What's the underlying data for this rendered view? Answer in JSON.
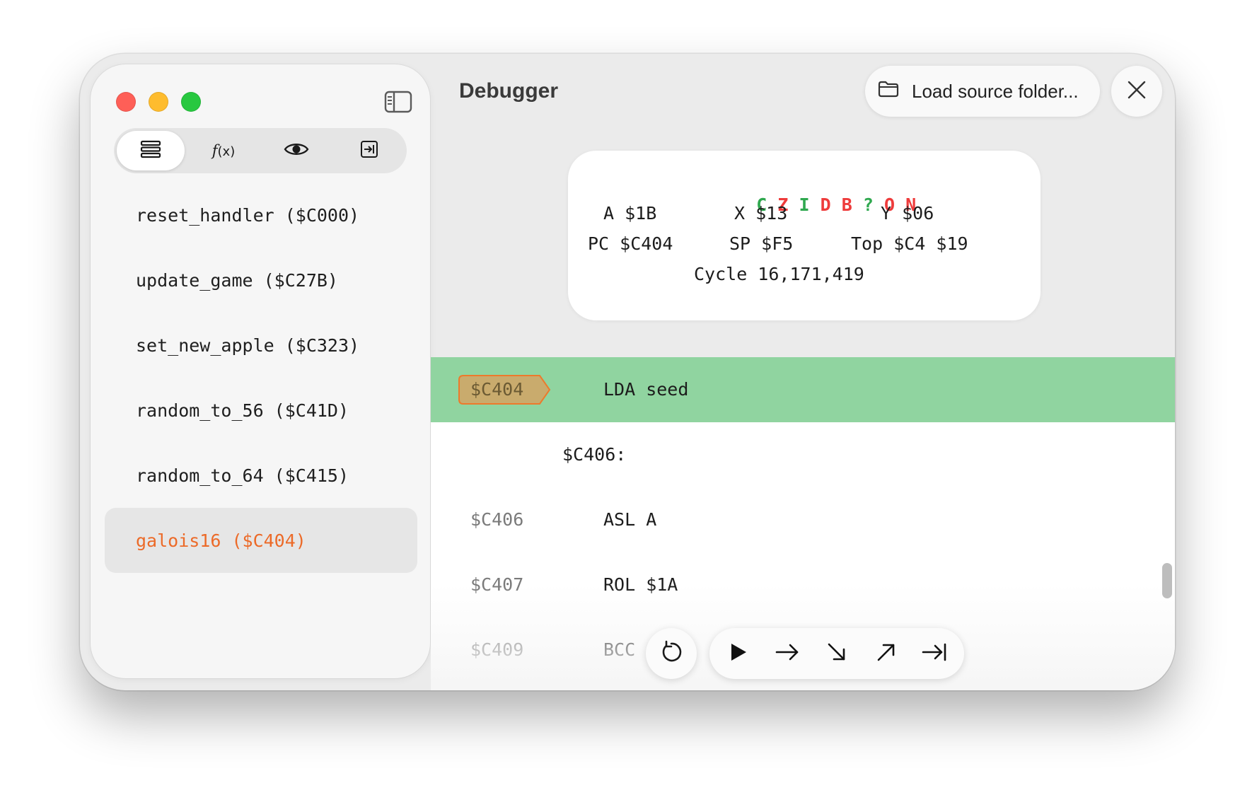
{
  "window": {
    "title": "Debugger"
  },
  "sidebar": {
    "tabs": [
      {
        "name": "symbols",
        "icon": "list-icon"
      },
      {
        "name": "functions",
        "icon": "function-icon",
        "label": "f",
        "label_suffix": "(x)"
      },
      {
        "name": "watch",
        "icon": "eye-icon"
      },
      {
        "name": "step-into",
        "icon": "arrow-to-line-icon"
      }
    ],
    "items": [
      {
        "label": "reset_handler ($C000)"
      },
      {
        "label": "update_game ($C27B)"
      },
      {
        "label": "set_new_apple ($C323)"
      },
      {
        "label": "random_to_56 ($C41D)"
      },
      {
        "label": "random_to_64 ($C415)"
      },
      {
        "label": "galois16 ($C404)"
      }
    ],
    "selected_index": 5
  },
  "header": {
    "load_label": "Load source folder..."
  },
  "registers": {
    "flags": [
      {
        "letter": "C",
        "set": true
      },
      {
        "letter": "Z",
        "set": false
      },
      {
        "letter": "I",
        "set": true
      },
      {
        "letter": "D",
        "set": false
      },
      {
        "letter": "B",
        "set": false
      },
      {
        "letter": "?",
        "set": true
      },
      {
        "letter": "O",
        "set": false
      },
      {
        "letter": "N",
        "set": false
      }
    ],
    "a": "A $1B",
    "x": "X $13",
    "y": "Y $06",
    "pc": "PC $C404",
    "sp": "SP $F5",
    "top": "Top $C4 $19",
    "cycle": "Cycle 16,171,419"
  },
  "code": {
    "current": {
      "address": "$C404",
      "instruction": "LDA seed"
    },
    "label": "$C406:",
    "lines": [
      {
        "address": "$C406",
        "instruction": "ASL A"
      },
      {
        "address": "$C407",
        "instruction": "ROL $1A"
      },
      {
        "address": "$C409",
        "instruction": "BCC"
      }
    ]
  },
  "controls": [
    "restart-icon",
    "play-icon",
    "step-over-icon",
    "step-into-icon",
    "step-out-icon",
    "run-to-end-icon"
  ],
  "colors": {
    "accent": "#ec6a28",
    "current_line": "#90d4a0",
    "flag_set": "#2fa84f",
    "flag_clear": "#ee3b3b"
  }
}
